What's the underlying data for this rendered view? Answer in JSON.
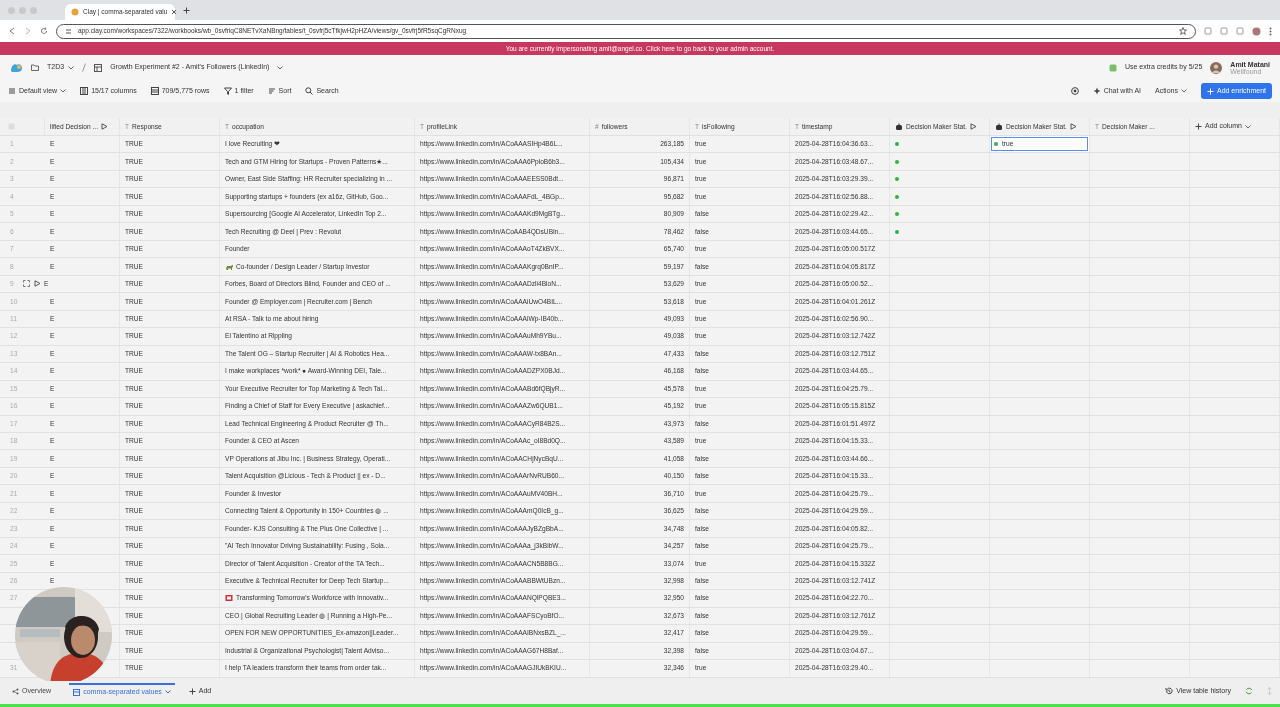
{
  "browser": {
    "tab_title": "Clay | comma-separated valu",
    "address": "app.clay.com/workspaces/7322/workbooks/wb_0svfriqC8NETvXaNBng/tables/t_0svfrj5cTfkjwH2pHZA/views/gv_0svfrj5fR5sqCgRNxug"
  },
  "banner": "You are currently impersonating amit@angel.co. Click here to go back to your admin account.",
  "header": {
    "workspace": "T2D3",
    "table_title": "Growth Experiment #2 - Amit's Followers (LinkedIn)",
    "credits": "Use extra credits by 5/25",
    "user_name": "Amit Matani",
    "user_org": "Wellfound"
  },
  "toolbar": {
    "view": "Default view",
    "columns": "15/17 columns",
    "rows": "709/5,775 rows",
    "filter": "1 filter",
    "sort": "Sort",
    "search": "Search",
    "chat": "Chat with AI",
    "actions": "Actions",
    "add_enrichment": "Add enrichment"
  },
  "columns": [
    {
      "label": "lified Decision ...",
      "kind": "formula"
    },
    {
      "label": "Response",
      "kind": "typed",
      "type_mark": "T"
    },
    {
      "label": "occupation",
      "kind": "typed",
      "type_mark": "T"
    },
    {
      "label": "profileLink",
      "kind": "typed",
      "type_mark": "T"
    },
    {
      "label": "followers",
      "kind": "typed",
      "type_mark": "#"
    },
    {
      "label": "isFollowing",
      "kind": "typed",
      "type_mark": "T"
    },
    {
      "label": "timestamp",
      "kind": "typed",
      "type_mark": "T"
    },
    {
      "label": "Decision Maker Stat.",
      "kind": "enrichment"
    },
    {
      "label": "Decision Maker Stat.",
      "kind": "enrichment"
    },
    {
      "label": "Decision Maker ...",
      "kind": "typed",
      "type_mark": "T"
    }
  ],
  "select_all": {
    "checked": false
  },
  "add_column": "Add column",
  "rows": [
    {
      "num": "1",
      "decision": "E",
      "response": "TRUE",
      "occupation": "I love Recruiting ❤",
      "link": "https://www.linkedin.com/in/ACoAAASIHp4B6L...",
      "followers": "263,185",
      "following": "true",
      "timestamp": "2025-04-28T16:04:36.63...",
      "status_dot": true,
      "status2": {
        "text": "true",
        "selected": true
      }
    },
    {
      "num": "2",
      "decision": "E",
      "response": "TRUE",
      "occupation": "Tech and GTM Hiring for Startups - Proven Patterns★...",
      "link": "https://www.linkedin.com/in/ACoAAA6PploB6b3...",
      "followers": "105,434",
      "following": "true",
      "timestamp": "2025-04-28T16:03:48.67...",
      "status_dot": true
    },
    {
      "num": "3",
      "decision": "E",
      "response": "TRUE",
      "occupation": "Owner, East Side Staffing: HR Recruiter specializing in ...",
      "link": "https://www.linkedin.com/in/ACoAAAEESS0Bdt...",
      "followers": "96,871",
      "following": "true",
      "timestamp": "2025-04-28T16:03:29.39...",
      "status_dot": true
    },
    {
      "num": "4",
      "decision": "E",
      "response": "TRUE",
      "occupation": "Supporting startups + founders (ex a16z, GitHub, Goo...",
      "link": "https://www.linkedin.com/in/ACoAAAFdL_4BGp...",
      "followers": "95,682",
      "following": "true",
      "timestamp": "2025-04-28T16:02:56.88...",
      "status_dot": true
    },
    {
      "num": "5",
      "decision": "E",
      "response": "TRUE",
      "occupation": "Supersourcing [Google AI Accelerator, LinkedIn Top 2...",
      "link": "https://www.linkedin.com/in/ACoAAAKd9MgBTg...",
      "followers": "80,909",
      "following": "false",
      "timestamp": "2025-04-28T16:02:29.42...",
      "status_dot": true
    },
    {
      "num": "6",
      "decision": "E",
      "response": "TRUE",
      "occupation": "Tech Recruiting @ Deel | Prev : Revolut",
      "link": "https://www.linkedin.com/in/ACoAAB4QDsUBIn...",
      "followers": "78,462",
      "following": "false",
      "timestamp": "2025-04-28T16:03:44.65...",
      "status_dot": true
    },
    {
      "num": "7",
      "decision": "E",
      "response": "TRUE",
      "occupation": "Founder",
      "link": "https://www.linkedin.com/in/ACoAAAoT4ZkBVX...",
      "followers": "65,740",
      "following": "true",
      "timestamp": "2025-04-28T16:05:00.517Z"
    },
    {
      "num": "8",
      "decision": "E",
      "response": "TRUE",
      "lead_icon": {
        "kind": "animal"
      },
      "occupation": "Co-founder / Design Leader / Startup Investor",
      "link": "https://www.linkedin.com/in/ACoAAAKgrq0BnIP...",
      "followers": "59,197",
      "following": "false",
      "timestamp": "2025-04-28T16:04:05.817Z"
    },
    {
      "num": "9",
      "decision": "E",
      "hover_tools": true,
      "response": "TRUE",
      "occupation": "Forbes, Board of Directors Blind, Founder and CEO of ...",
      "link": "https://www.linkedin.com/in/ACoAAADzli4BloN...",
      "followers": "53,629",
      "following": "true",
      "timestamp": "2025-04-28T16:05:00.52..."
    },
    {
      "num": "10",
      "decision": "E",
      "response": "TRUE",
      "occupation": "Founder @ Employer.com | Recruiter.com | Bench",
      "link": "https://www.linkedin.com/in/ACoAAAiUwO4BIL...",
      "followers": "53,618",
      "following": "true",
      "timestamp": "2025-04-28T16:04:01.261Z"
    },
    {
      "num": "11",
      "decision": "E",
      "response": "TRUE",
      "occupation": "At RSA - Talk to me about hiring",
      "link": "https://www.linkedin.com/in/ACoAAAiWp-IB40b...",
      "followers": "49,093",
      "following": "true",
      "timestamp": "2025-04-28T16:02:56.90..."
    },
    {
      "num": "12",
      "decision": "E",
      "response": "TRUE",
      "occupation": "El Talentino at Rippling",
      "link": "https://www.linkedin.com/in/ACoAAAuMh9YBu...",
      "followers": "49,038",
      "following": "true",
      "timestamp": "2025-04-28T16:03:12.742Z"
    },
    {
      "num": "13",
      "decision": "E",
      "response": "TRUE",
      "occupation": "The Talent OG – Startup Recruiter | AI & Robotics Hea...",
      "link": "https://www.linkedin.com/in/ACoAAAW-tx8BAn...",
      "followers": "47,433",
      "following": "false",
      "timestamp": "2025-04-28T16:03:12.751Z"
    },
    {
      "num": "14",
      "decision": "E",
      "response": "TRUE",
      "occupation": "I make workplaces *work* ● Award-Winning DEI, Tale...",
      "link": "https://www.linkedin.com/in/ACoAAADZPX0BJd...",
      "followers": "46,168",
      "following": "false",
      "timestamp": "2025-04-28T16:03:44.65..."
    },
    {
      "num": "15",
      "decision": "E",
      "response": "TRUE",
      "occupation": "Your Executive Recruiter for Top Marketing & Tech Tal...",
      "link": "https://www.linkedin.com/in/ACoAAABd6fQBjyR...",
      "followers": "45,578",
      "following": "true",
      "timestamp": "2025-04-28T16:04:25.79..."
    },
    {
      "num": "16",
      "decision": "E",
      "response": "TRUE",
      "occupation": "Finding a Chief of Staff for Every Executive | askachief...",
      "link": "https://www.linkedin.com/in/ACoAAAZw6QUB1...",
      "followers": "45,192",
      "following": "true",
      "timestamp": "2025-04-28T16:05:15.815Z"
    },
    {
      "num": "17",
      "decision": "E",
      "response": "TRUE",
      "occupation": "Lead Technical Engineering & Product Recruiter @ Th...",
      "link": "https://www.linkedin.com/in/ACoAAACyR84B2S...",
      "followers": "43,973",
      "following": "false",
      "timestamp": "2025-04-28T16:01:51.497Z"
    },
    {
      "num": "18",
      "decision": "E",
      "response": "TRUE",
      "occupation": "Founder & CEO at Ascen",
      "link": "https://www.linkedin.com/in/ACoAAAc_oI8Bd0Q...",
      "followers": "43,589",
      "following": "true",
      "timestamp": "2025-04-28T16:04:15.33..."
    },
    {
      "num": "19",
      "decision": "E",
      "response": "TRUE",
      "occupation": "VP Operations at Jibu Inc. | Business Strategy, Operati...",
      "link": "https://www.linkedin.com/in/ACoAACHjNycBqU...",
      "followers": "41,058",
      "following": "false",
      "timestamp": "2025-04-28T16:03:44.66..."
    },
    {
      "num": "20",
      "decision": "E",
      "response": "TRUE",
      "occupation": "Talent Acquisition @Licious - Tech & Product || ex - D...",
      "link": "https://www.linkedin.com/in/ACoAAArNvRUB60...",
      "followers": "40,150",
      "following": "false",
      "timestamp": "2025-04-28T16:04:15.33..."
    },
    {
      "num": "21",
      "decision": "E",
      "response": "TRUE",
      "occupation": "Founder & Investor",
      "link": "https://www.linkedin.com/in/ACoAAAuMV40BH...",
      "followers": "36,710",
      "following": "true",
      "timestamp": "2025-04-28T16:04:25.79..."
    },
    {
      "num": "22",
      "decision": "E",
      "response": "TRUE",
      "occupation": "Connecting Talent & Opportunity in 150+ Countries ◍ ...",
      "link": "https://www.linkedin.com/in/ACoAAAmQ0IcB_g...",
      "followers": "36,625",
      "following": "false",
      "timestamp": "2025-04-28T16:04:29.59..."
    },
    {
      "num": "23",
      "decision": "E",
      "response": "TRUE",
      "occupation": "Founder- KJS Consulting & The Plus One Collective | ...",
      "link": "https://www.linkedin.com/in/ACoAAAJyBZgBbA...",
      "followers": "34,748",
      "following": "false",
      "timestamp": "2025-04-28T16:04:05.82..."
    },
    {
      "num": "24",
      "decision": "E",
      "response": "TRUE",
      "occupation": "\"AI Tech Innovator Driving Sustainability: Fusing , Sola...",
      "link": "https://www.linkedin.com/in/ACoAAAa_j3kBibW...",
      "followers": "34,257",
      "following": "false",
      "timestamp": "2025-04-28T16:04:25.79..."
    },
    {
      "num": "25",
      "decision": "E",
      "response": "TRUE",
      "occupation": "Director of Talent Acquisition - Creator of the TA Tech...",
      "link": "https://www.linkedin.com/in/ACoAAACN5B8BG...",
      "followers": "33,074",
      "following": "true",
      "timestamp": "2025-04-28T16:04:15.332Z"
    },
    {
      "num": "26",
      "decision": "E",
      "response": "TRUE",
      "occupation": "Executive & Technical Recruiter for Deep Tech Startup...",
      "link": "https://www.linkedin.com/in/ACoAAABBWtUBzn...",
      "followers": "32,998",
      "following": "false",
      "timestamp": "2025-04-28T16:03:12.741Z"
    },
    {
      "num": "27",
      "response": "TRUE",
      "lead_icon": {
        "kind": "square"
      },
      "occupation": "Transforming Tomorrow's Workforce with Innovativ...",
      "link": "https://www.linkedin.com/in/ACoAAANQlPQBE3...",
      "followers": "32,950",
      "following": "false",
      "timestamp": "2025-04-28T16:04:22.70..."
    },
    {
      "response": "TRUE",
      "occupation": "CEO | Global Recruiting Leader ◍ | Running a High-Pe...",
      "link": "https://www.linkedin.com/in/ACoAAAFSCyoBfO...",
      "followers": "32,673",
      "following": "false",
      "timestamp": "2025-04-28T16:03:12.761Z"
    },
    {
      "response": "TRUE",
      "occupation": "OPEN FOR NEW OPPORTUNITIES_Ex-amazon||Leader...",
      "link": "https://www.linkedin.com/in/ACoAAAIBNxsBZL_...",
      "followers": "32,417",
      "following": "false",
      "timestamp": "2025-04-28T16:04:29.59..."
    },
    {
      "response": "TRUE",
      "occupation": "Industrial & Organizational Psychologist| Talent Adviso...",
      "link": "https://www.linkedin.com/in/ACoAAAG67H8Baf...",
      "followers": "32,398",
      "following": "false",
      "timestamp": "2025-04-28T16:03:04.67..."
    },
    {
      "num": "31",
      "response": "TRUE",
      "occupation": "I help TA leaders transform their teams from order tak...",
      "link": "https://www.linkedin.com/in/ACoAAAGJIUkBKIU...",
      "followers": "32,346",
      "following": "true",
      "timestamp": "2025-04-28T16:03:29.40..."
    }
  ],
  "bottom_tabs": [
    {
      "label": "Overview",
      "kind": "overview",
      "selected": false
    },
    {
      "label": "comma-separated values",
      "kind": "table",
      "selected": true
    }
  ],
  "add_tab": "Add",
  "history": "View table history"
}
